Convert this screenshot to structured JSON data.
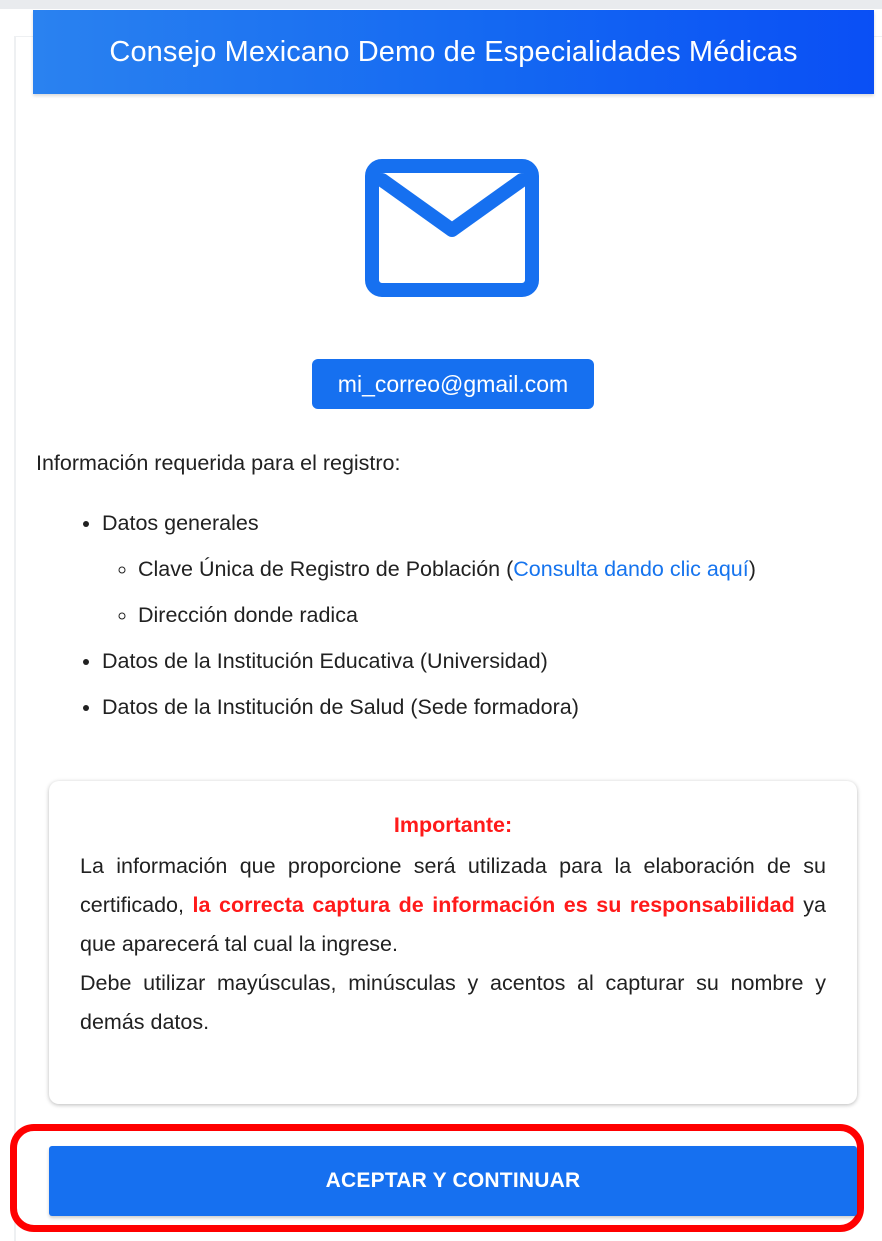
{
  "header": {
    "title": "Consejo Mexicano Demo de Especialidades Médicas"
  },
  "icons": {
    "mail": "envelope-icon"
  },
  "colors": {
    "primary": "#1670f0",
    "header_gradient_end": "#0a4ff5",
    "important_red": "#ff1a1a",
    "highlight_frame": "#ff0000",
    "link": "#1674ee"
  },
  "email": {
    "value": "mi_correo@gmail.com"
  },
  "info": {
    "heading": "Información requerida para el registro:",
    "general": "Datos generales",
    "curp_prefix": "Clave Única de Registro de Población (",
    "curp_link": "Consulta dando clic aquí",
    "curp_suffix": ")",
    "address": "Dirección donde radica",
    "education": "Datos de la Institución Educativa (Universidad)",
    "health": "Datos de la Institución de Salud (Sede formadora)"
  },
  "notice": {
    "title": "Importante:",
    "text_1": "La información que proporcione será utilizada para la elaboración de su certificado, ",
    "highlight": "la correcta captura de información es su responsabilidad",
    "text_2": " ya que aparecerá tal cual la ingrese.",
    "text_3": "Debe utilizar mayúsculas, minúsculas y acentos al capturar su nombre y demás datos."
  },
  "actions": {
    "accept_label": "ACEPTAR Y CONTINUAR"
  }
}
